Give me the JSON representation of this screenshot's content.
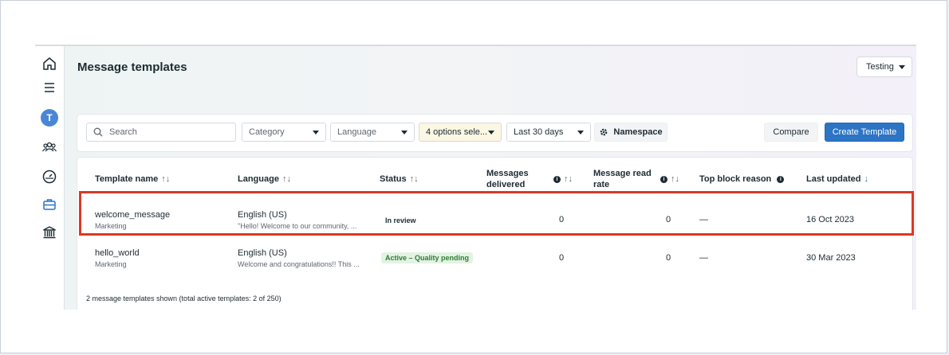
{
  "page": {
    "title": "Message templates"
  },
  "env_select": {
    "value": "Testing"
  },
  "sidebar": {
    "icons": [
      "home-icon",
      "menu-icon",
      "avatar",
      "people-icon",
      "dashboard-icon",
      "briefcase-icon",
      "bank-icon"
    ],
    "avatar_letter": "T"
  },
  "filters": {
    "search_placeholder": "Search",
    "category": "Category",
    "language": "Language",
    "options": "4 options sele...",
    "date_range": "Last 30 days",
    "namespace": "Namespace",
    "compare": "Compare",
    "create": "Create Template"
  },
  "table": {
    "headers": {
      "name": "Template name",
      "language": "Language",
      "status": "Status",
      "delivered_1": "Messages",
      "delivered_2": "delivered",
      "read_1": "Message read",
      "read_2": "rate",
      "block": "Top block reason",
      "updated": "Last updated"
    },
    "rows": [
      {
        "name": "welcome_message",
        "category": "Marketing",
        "language": "English (US)",
        "preview": "\"Hello! Welcome to our community, ...",
        "status": "In review",
        "delivered": "0",
        "read_rate": "0",
        "block": "—",
        "updated": "16 Oct 2023"
      },
      {
        "name": "hello_world",
        "category": "Marketing",
        "language": "English (US)",
        "preview": "Welcome and congratulations!! This ...",
        "status": "Active – Quality pending",
        "delivered": "0",
        "read_rate": "0",
        "block": "—",
        "updated": "30 Mar 2023"
      }
    ],
    "footer": "2 message templates shown (total active templates: 2 of 250)"
  },
  "colors": {
    "primary": "#2d74c4",
    "highlight": "#d93a22",
    "active": "#2f7d32"
  }
}
